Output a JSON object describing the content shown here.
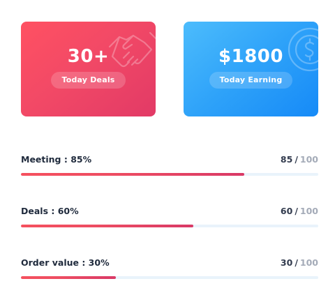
{
  "cards": [
    {
      "value": "30+",
      "label": "Today Deals",
      "icon": "handshake-icon",
      "color": "#f24966"
    },
    {
      "value": "$1800",
      "label": "Today Earning",
      "icon": "dollar-coin-icon",
      "color": "#2ea2f9"
    }
  ],
  "progress": [
    {
      "label": "Meeting : 85%",
      "current": "85",
      "separator": "/",
      "total": "100",
      "fraction": 0.75
    },
    {
      "label": "Deals : 60%",
      "current": "60",
      "separator": "/",
      "total": "100",
      "fraction": 0.58
    },
    {
      "label": "Order value : 30%",
      "current": "30",
      "separator": "/",
      "total": "100",
      "fraction": 0.32
    }
  ],
  "colors": {
    "progress_fill": "#e8445f",
    "progress_track": "#e9f3fb",
    "text_dark": "#1f2a3c",
    "text_muted": "#a4abb8"
  }
}
